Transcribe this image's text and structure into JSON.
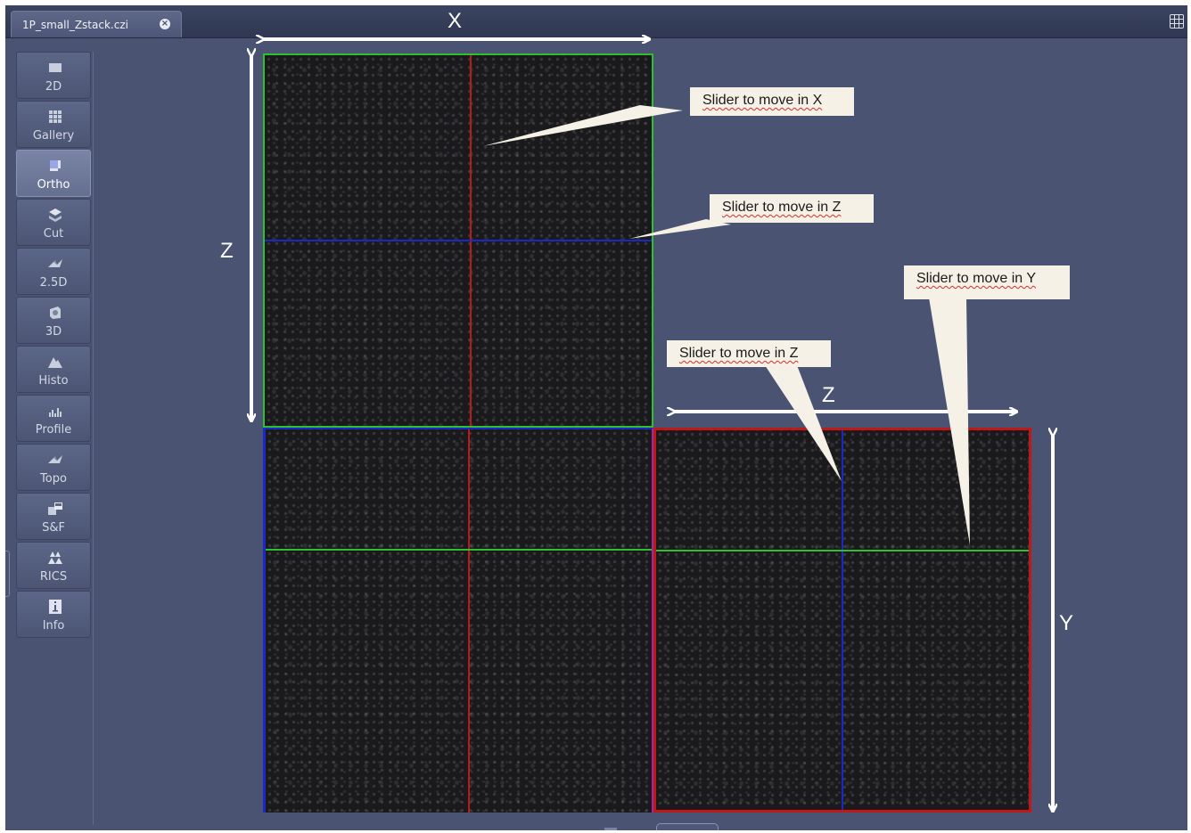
{
  "tab": {
    "label": "1P_small_Zstack.czi"
  },
  "sidebar": {
    "items": [
      {
        "label": "2D",
        "icon": "rectangle-icon"
      },
      {
        "label": "Gallery",
        "icon": "grid-icon"
      },
      {
        "label": "Ortho",
        "icon": "ortho-icon",
        "active": true
      },
      {
        "label": "Cut",
        "icon": "cut-icon"
      },
      {
        "label": "2.5D",
        "icon": "surface-icon"
      },
      {
        "label": "3D",
        "icon": "cube-icon"
      },
      {
        "label": "Histo",
        "icon": "histogram-icon"
      },
      {
        "label": "Profile",
        "icon": "profile-icon"
      },
      {
        "label": "Topo",
        "icon": "topo-icon"
      },
      {
        "label": "S&F",
        "icon": "stitch-icon"
      },
      {
        "label": "RICS",
        "icon": "rics-icon"
      },
      {
        "label": "Info",
        "icon": "info-icon"
      }
    ]
  },
  "axes": {
    "x": "X",
    "z_left": "Z",
    "z_top": "Z",
    "y": "Y"
  },
  "callouts": {
    "slider_x": "Slider to move in X",
    "slider_z_top": "Slider to move in Z",
    "slider_y": "Slider to move in Y",
    "slider_z_right": "Slider to move in Z"
  },
  "colors": {
    "background": "#4a5472",
    "x_slider": "#c01818",
    "y_slider": "#2ec02e",
    "z_slider": "#1a28c8",
    "callout_bg": "#f5f1e6"
  }
}
